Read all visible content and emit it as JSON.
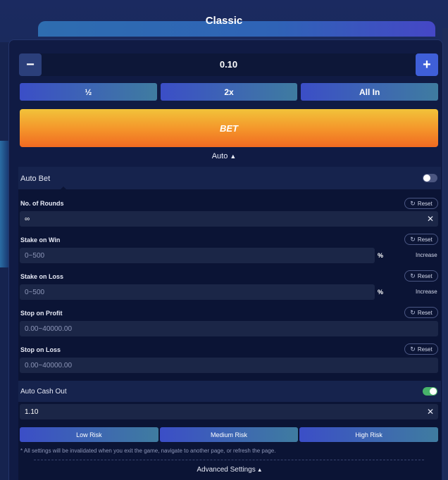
{
  "header": {
    "title": "Classic"
  },
  "amount": {
    "value": "0.10",
    "minus_label": "−",
    "plus_label": "+"
  },
  "multipliers": [
    {
      "label": "½"
    },
    {
      "label": "2x"
    },
    {
      "label": "All In"
    }
  ],
  "bet_button": {
    "label": "BET"
  },
  "auto_toggle": {
    "label": "Auto",
    "icon": "triangle-up-icon"
  },
  "auto_bet": {
    "label": "Auto Bet",
    "enabled": false
  },
  "fields": {
    "rounds": {
      "label": "No. of Rounds",
      "value": "∞",
      "reset": "Reset"
    },
    "stake_win": {
      "label": "Stake on Win",
      "placeholder": "0~500",
      "unit": "%",
      "mode": "Increase",
      "reset": "Reset"
    },
    "stake_loss": {
      "label": "Stake on Loss",
      "placeholder": "0~500",
      "unit": "%",
      "mode": "Increase",
      "reset": "Reset"
    },
    "stop_profit": {
      "label": "Stop on Profit",
      "placeholder": "0.00~40000.00",
      "reset": "Reset"
    },
    "stop_loss": {
      "label": "Stop on Loss",
      "placeholder": "0.00~40000.00",
      "reset": "Reset"
    }
  },
  "auto_cash_out": {
    "label": "Auto Cash Out",
    "enabled": true,
    "value": "1.10"
  },
  "risk_levels": [
    {
      "label": "Low Risk"
    },
    {
      "label": "Medium Risk"
    },
    {
      "label": "High Risk"
    }
  ],
  "note": "* All settings will be invalidated when you exit the game, navigate to another page, or refresh the page.",
  "advanced_settings": {
    "label": "Advanced Settings"
  },
  "colors": {
    "background": "#16234f",
    "panel": "#101b44",
    "accent_blue": "#3f5fd8",
    "bet_gradient_top": "#f2c33a",
    "bet_gradient_bottom": "#f06a22",
    "toggle_on": "#47b36a"
  }
}
